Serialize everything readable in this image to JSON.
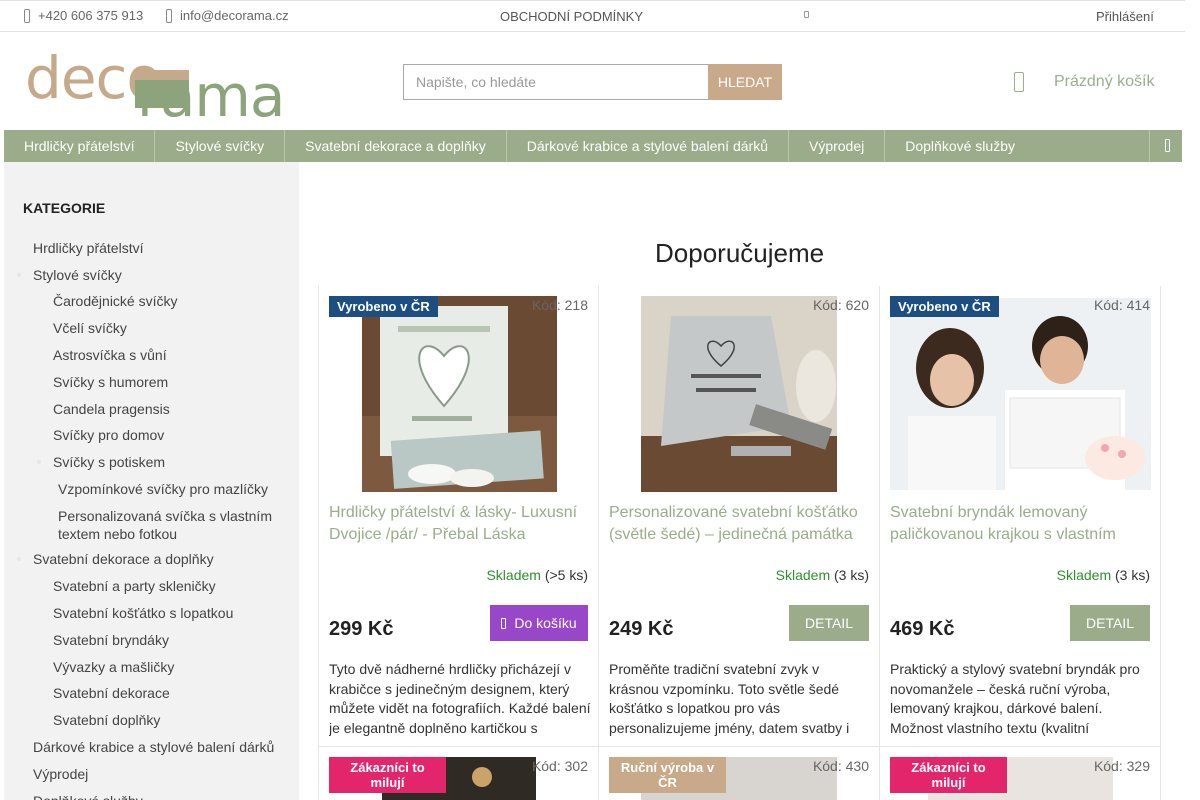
{
  "topbar": {
    "phone": "+420 606 375 913",
    "email": "info@decorama.cz",
    "terms": "OBCHODNÍ PODMÍNKY",
    "login": "Přihlášení"
  },
  "header": {
    "logo_part1": "deco",
    "logo_part2": "rama",
    "search_placeholder": "Napište, co hledáte",
    "search_button": "HLEDAT",
    "cart_label": "Prázdný košík"
  },
  "nav": {
    "items": [
      {
        "label": "Hrdličky přátelství"
      },
      {
        "label": "Stylové svíčky"
      },
      {
        "label": "Svatební dekorace a doplňky"
      },
      {
        "label": "Dárkové krabice a stylové balení dárků"
      },
      {
        "label": "Výprodej"
      },
      {
        "label": "Doplňkové služby"
      }
    ]
  },
  "sidebar": {
    "heading": "KATEGORIE",
    "items": [
      {
        "label": "Hrdličky přátelství"
      },
      {
        "label": "Stylové svíčky"
      },
      {
        "label": "Čarodějnické svíčky"
      },
      {
        "label": "Včelí svíčky"
      },
      {
        "label": "Astrosvíčka s vůní"
      },
      {
        "label": "Svíčky s humorem"
      },
      {
        "label": "Candela pragensis"
      },
      {
        "label": "Svíčky pro domov"
      },
      {
        "label": "Svíčky s potiskem"
      },
      {
        "label": "Vzpomínkové svíčky pro mazlíčky"
      },
      {
        "label": "Personalizovaná svíčka s vlastním textem nebo fotkou"
      },
      {
        "label": "Svatební dekorace a doplňky"
      },
      {
        "label": "Svatební a party skleničky"
      },
      {
        "label": "Svatební košťátko s lopatkou"
      },
      {
        "label": "Svatební bryndáky"
      },
      {
        "label": "Vývazky a mašličky"
      },
      {
        "label": "Svatební dekorace"
      },
      {
        "label": "Svatební doplňky"
      },
      {
        "label": "Dárkové krabice a stylové balení dárků"
      },
      {
        "label": "Výprodej"
      },
      {
        "label": "Doplňkové služby"
      }
    ]
  },
  "main": {
    "title": "Doporučujeme",
    "products": [
      {
        "badge": "Vyrobeno v ČR",
        "code": "Kód: 218",
        "name": "Hrdličky přátelství & lásky- Luxusní Dvojice /pár/ - Přebal Láska",
        "stock_status": "Skladem",
        "stock_qty": "(>5 ks)",
        "price": "299 Kč",
        "button": "Do košíku",
        "description": "Tyto dvě nádherné hrdličky přicházejí v krabičce s jedinečným designem, který můžete vidět na fotografiích. Každé balení je elegantně doplněno kartičkou s"
      },
      {
        "badge": "",
        "code": "Kód: 620",
        "name": "Personalizované svatební košťátko (světle šedé) – jedinečná památka",
        "stock_status": "Skladem",
        "stock_qty": "(3 ks)",
        "price": "249 Kč",
        "button": "DETAIL",
        "description": "Proměňte tradiční svatební zvyk v krásnou vzpomínku. Toto světle šedé košťátko s lopatkou pro vás personalizujeme jmény, datem svatby i"
      },
      {
        "badge": "Vyrobeno v ČR",
        "code": "Kód: 414",
        "name": "Svatební bryndák lemovaný paličkovanou krajkou s vlastním",
        "stock_status": "Skladem",
        "stock_qty": "(3 ks)",
        "price": "469 Kč",
        "button": "DETAIL",
        "description": "Praktický a stylový svatební bryndák pro novomanžele – česká ruční výroba, lemovaný krajkou, dárkové balení. Možnost vlastního textu (kvalitní"
      }
    ],
    "row2": [
      {
        "badge": "Zákazníci to milují",
        "code": "Kód: 302",
        "badge_color": "#e3266b"
      },
      {
        "badge": "Ruční výroba v ČR",
        "code": "Kód: 430",
        "badge_color": "#c8a98a"
      },
      {
        "badge": "Zákazníci to milují",
        "code": "Kód: 329",
        "badge_color": "#e3266b"
      }
    ]
  },
  "colors": {
    "brand_green": "#9aac89",
    "brand_tan": "#c8a98a",
    "badge_blue": "#1c4e82",
    "cart_purple": "#9747c8",
    "stock_green": "#2f8f2f"
  }
}
